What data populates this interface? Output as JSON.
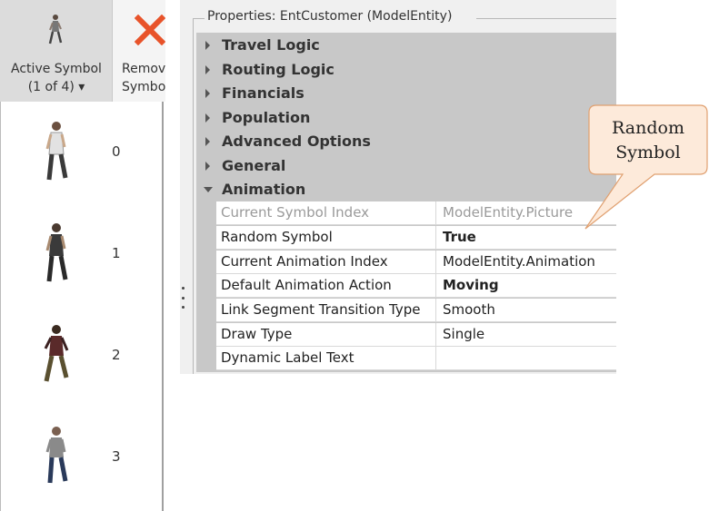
{
  "ribbon": {
    "active_symbol_line1": "Active Symbol",
    "active_symbol_line2": "(1 of 4) ▾",
    "remove_symbol_line1": "Remov",
    "remove_symbol_line2": "Symbo"
  },
  "symbols": [
    {
      "index": "0"
    },
    {
      "index": "1"
    },
    {
      "index": "2"
    },
    {
      "index": "3"
    }
  ],
  "properties": {
    "title": "Properties: EntCustomer (ModelEntity)",
    "categories": [
      {
        "label": "Travel Logic"
      },
      {
        "label": "Routing Logic"
      },
      {
        "label": "Financials"
      },
      {
        "label": "Population"
      },
      {
        "label": "Advanced Options"
      },
      {
        "label": "General"
      },
      {
        "label": "Animation"
      }
    ],
    "animation_rows": [
      {
        "name": "Current Symbol Index",
        "value": "ModelEntity.Picture"
      },
      {
        "name": "Random Symbol",
        "value": "True"
      },
      {
        "name": "Current Animation Index",
        "value": "ModelEntity.Animation"
      },
      {
        "name": "Default Animation Action",
        "value": "Moving"
      },
      {
        "name": "Link Segment Transition Type",
        "value": "Smooth"
      },
      {
        "name": "Draw Type",
        "value": "Single"
      },
      {
        "name": "Dynamic Label Text",
        "value": ""
      }
    ]
  },
  "callout": {
    "line1": "Random",
    "line2": "Symbol",
    "fill": "#fdeada",
    "border": "#e0a070"
  },
  "colors": {
    "remove_icon": "#e8532a",
    "panel_bg": "#f0f0f0",
    "category_bg": "#c8c8c8"
  }
}
